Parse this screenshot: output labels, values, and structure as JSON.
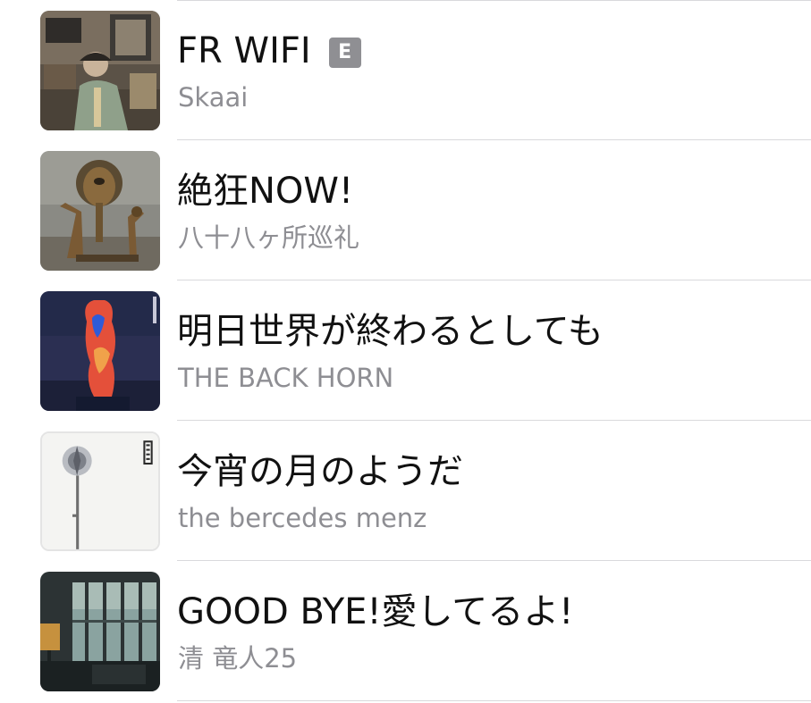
{
  "songs": [
    {
      "title": "FR WIFI",
      "artist": "Skaai",
      "explicit": true,
      "explicit_label": "E"
    },
    {
      "title": "絶狂NOW!",
      "artist": "八十八ヶ所巡礼",
      "explicit": false
    },
    {
      "title": "明日世界が終わるとしても",
      "artist": "THE BACK HORN",
      "explicit": false
    },
    {
      "title": "今宵の月のようだ",
      "artist": "the bercedes menz",
      "explicit": false
    },
    {
      "title": "GOOD BYE!愛してるよ!",
      "artist": "清 竜人25",
      "explicit": false
    }
  ],
  "colors": {
    "title_text": "#111111",
    "artist_text": "#8e8e93",
    "divider": "#d9d9dc",
    "explicit_badge": "#8f8f93"
  }
}
